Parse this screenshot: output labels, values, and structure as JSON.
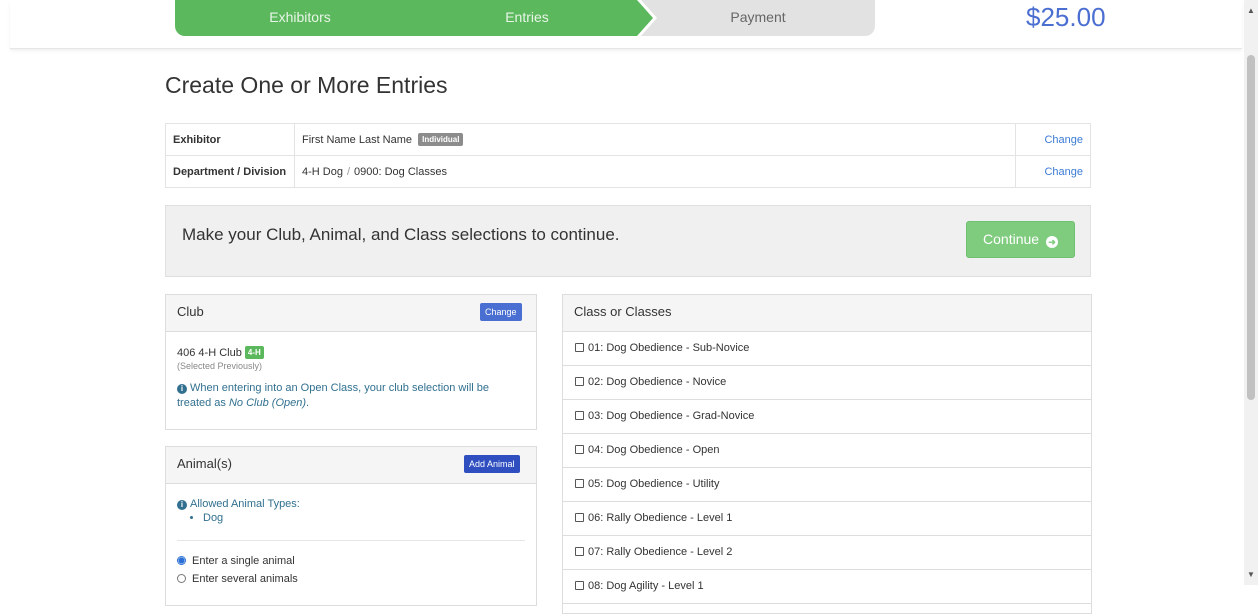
{
  "steps": [
    "Exhibitors",
    "Entries",
    "Payment"
  ],
  "total": "$25.00",
  "page_title": "Create One or More Entries",
  "info": {
    "exhibitor_label": "Exhibitor",
    "exhibitor_name": "First Name Last Name",
    "exhibitor_badge": "Individual",
    "exhibitor_change": "Change",
    "division_label": "Department / Division",
    "department": "4-H Dog",
    "separator": "/",
    "division": "0900: Dog Classes",
    "division_change": "Change"
  },
  "notice": {
    "text": "Make your Club, Animal, and Class selections to continue.",
    "continue_label": "Continue"
  },
  "club": {
    "title": "Club",
    "change_label": "Change",
    "name": "406 4-H Club",
    "badge": "4-H",
    "status": "(Selected Previously)",
    "note_prefix": "When entering into an Open Class, your club selection will be treated as ",
    "note_emph": "No Club (Open)",
    "note_suffix": "."
  },
  "animals": {
    "title": "Animal(s)",
    "add_label": "Add Animal",
    "allowed_head": "Allowed Animal Types:",
    "allowed_types": [
      "Dog"
    ],
    "options": [
      "Enter a single animal",
      "Enter several animals"
    ]
  },
  "classes": {
    "title": "Class or Classes",
    "items": [
      "01: Dog Obedience - Sub-Novice",
      "02: Dog Obedience - Novice",
      "03: Dog Obedience - Grad-Novice",
      "04: Dog Obedience - Open",
      "05: Dog Obedience - Utility",
      "06: Rally Obedience - Level 1",
      "07: Rally Obedience - Level 2",
      "08: Dog Agility - Level 1"
    ]
  },
  "colors": {
    "step_done": "#5cb85c",
    "step_pending": "#e2e2e2",
    "total": "#4b6ed1",
    "continue_disabled": "#7fcc7f",
    "club_change_btn": "#4a6fd2",
    "add_animal_btn": "#2f4fc0"
  }
}
